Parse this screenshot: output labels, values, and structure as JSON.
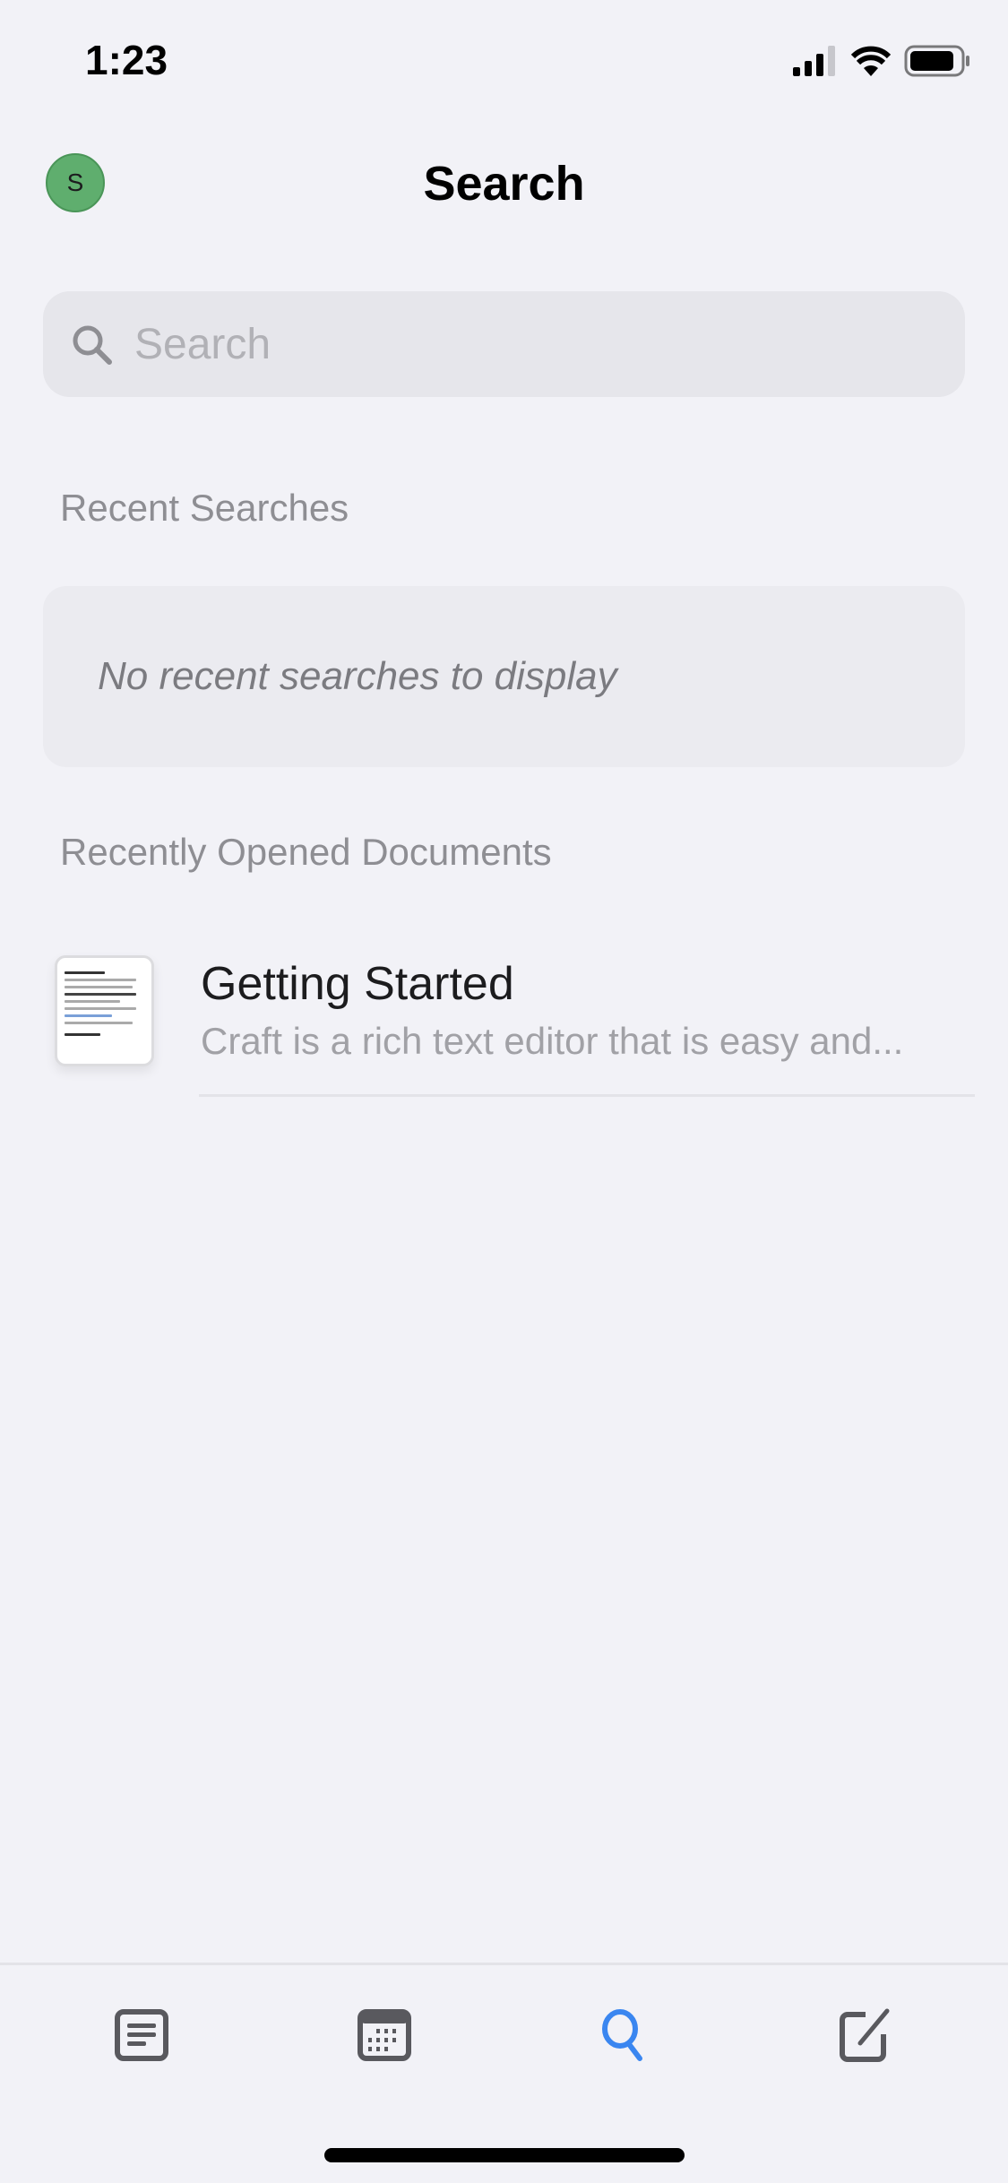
{
  "status_bar": {
    "time": "1:23"
  },
  "header": {
    "avatar_initial": "S",
    "title": "Search"
  },
  "search": {
    "placeholder": "Search",
    "value": ""
  },
  "recent_searches": {
    "heading": "Recent Searches",
    "empty_text": "No recent searches to display"
  },
  "recent_documents": {
    "heading": "Recently Opened Documents",
    "items": [
      {
        "title": "Getting Started",
        "preview": "Craft is a rich text editor that is easy and..."
      }
    ]
  },
  "tab_bar": {
    "active": "search",
    "items": [
      "documents",
      "calendar",
      "search",
      "new-document"
    ],
    "active_color": "#3a86f0",
    "inactive_color": "#59595e"
  }
}
